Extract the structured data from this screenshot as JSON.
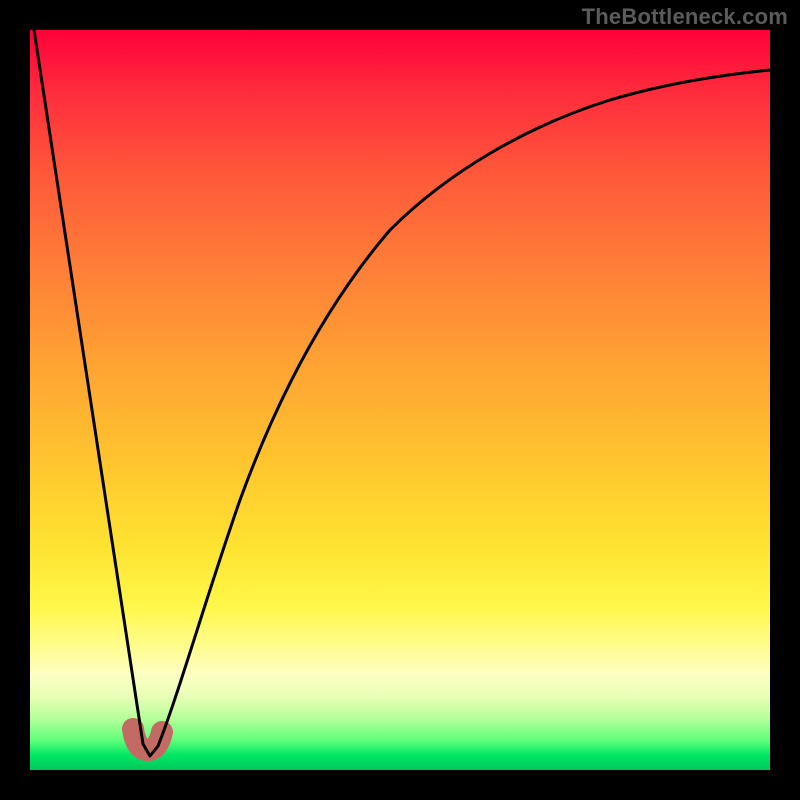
{
  "watermark": "TheBottleneck.com",
  "colors": {
    "background": "#000000",
    "curve": "#000000",
    "marker": "#c36a64"
  },
  "chart_data": {
    "type": "line",
    "title": "",
    "xlabel": "",
    "ylabel": "",
    "xlim": [
      0,
      100
    ],
    "ylim": [
      0,
      100
    ],
    "grid": false,
    "series": [
      {
        "name": "bottleneck-curve",
        "x": [
          0,
          5,
          10,
          14,
          15,
          16,
          17,
          20,
          23,
          27,
          32,
          38,
          45,
          55,
          65,
          78,
          90,
          100
        ],
        "y": [
          100,
          68,
          35,
          9,
          3,
          1,
          2,
          10,
          22,
          37,
          52,
          64,
          74,
          82,
          87,
          91,
          93.5,
          95
        ]
      }
    ],
    "marker": {
      "name": "minimum-J",
      "x_range": [
        12.5,
        17
      ],
      "y_range": [
        1,
        4
      ]
    },
    "gradient_stops": [
      {
        "pos": 0.0,
        "color": "#ff003a"
      },
      {
        "pos": 0.45,
        "color": "#ffa233"
      },
      {
        "pos": 0.78,
        "color": "#fff84a"
      },
      {
        "pos": 0.93,
        "color": "#b6ff9a"
      },
      {
        "pos": 1.0,
        "color": "#00c95a"
      }
    ]
  }
}
